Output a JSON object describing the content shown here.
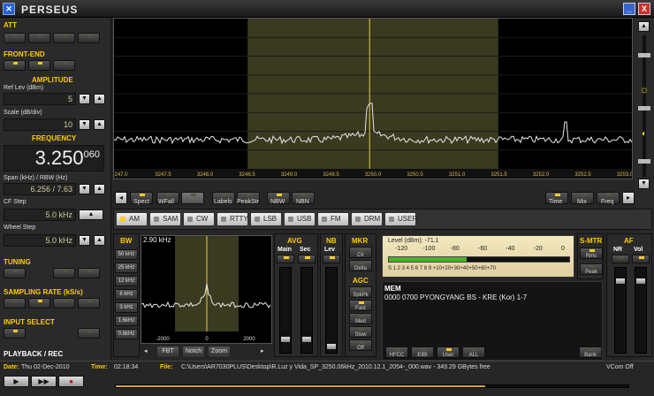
{
  "window": {
    "title": "PERSEUS",
    "minimize_label": "_",
    "close_label": "X"
  },
  "left": {
    "att_title": "ATT",
    "frontend_title": "FRONT-END",
    "amplitude_title": "AMPLITUDE",
    "ref_lev_label": "Ref Lev (dBm)",
    "ref_lev_value": "5",
    "scale_label": "Scale (dB/div)",
    "scale_value": "10",
    "frequency_title": "FREQUENCY",
    "frequency_main": "3.250",
    "frequency_sub": "060",
    "span_label": "Span (kHz) / RBW (Hz)",
    "span_value": "6.256 / 7.63",
    "cf_step_label": "CF Step",
    "cf_step_value": "5.0 kHz",
    "wheel_step_label": "Wheel Step",
    "wheel_step_value": "5.0 kHz",
    "tuning_title": "TUNING",
    "sampling_title": "SAMPLING RATE (kS/s)",
    "input_title": "INPUT SELECT",
    "playback_title": "PLAYBACK / REC",
    "arrow_up": "▲",
    "arrow_down": "▼"
  },
  "spectrum": {
    "x_ticks": [
      "247.0",
      "3247.5",
      "3248.0",
      "3248.5",
      "3249.0",
      "3249.5",
      "3250.0",
      "3250.5",
      "3251.0",
      "3251.5",
      "3252.0",
      "3252.5",
      "3253.0"
    ],
    "passband_from": 3248.6,
    "passband_to": 3251.6,
    "center": 3250.06
  },
  "under_buttons": {
    "spect": "Spect",
    "wfall": "WFall",
    "labels": "Labels",
    "peakstr": "PeakStr",
    "nbw": "NBW",
    "nbn": "NBN",
    "time": "Time",
    "mix": "Mix",
    "freq": "Freq"
  },
  "modes": [
    {
      "label": "AM",
      "active": true
    },
    {
      "label": "SAM",
      "active": false
    },
    {
      "label": "CW",
      "active": false
    },
    {
      "label": "RTTY",
      "active": false
    },
    {
      "label": "LSB",
      "active": false
    },
    {
      "label": "USB",
      "active": false
    },
    {
      "label": "FM",
      "active": false
    },
    {
      "label": "DRM",
      "active": false
    },
    {
      "label": "USER",
      "active": false
    }
  ],
  "bw": {
    "title": "BW",
    "items": [
      "50 kHz",
      "25 kHz",
      "12 kHz",
      "6 kHz",
      "3 kHz",
      "1.6kHz",
      "0.8kHz"
    ],
    "scope_label": "2.90 kHz",
    "scope_ticks": [
      "-2000",
      "0",
      "2000"
    ],
    "fbt": "FBT",
    "notch": "Notch",
    "zoom": "Zoom"
  },
  "avg": {
    "title": "AVG",
    "main": "Main",
    "sec": "Sec"
  },
  "nb": {
    "title": "NB",
    "lev": "Lev"
  },
  "mkr": {
    "title": "MKR",
    "clr": "Clr",
    "delta": "Delta"
  },
  "agc": {
    "title": "AGC",
    "options": [
      "SpkPk",
      "Fast",
      "Med",
      "Slow",
      "Off"
    ]
  },
  "meter": {
    "level_text": "Level (dBm): -71.1",
    "dbm_scale": [
      "-120",
      "-100",
      "-80",
      "-60",
      "-40",
      "-20",
      "0"
    ],
    "s_scale": "S 1 2 3 4 5 6 7 8 9 +10+20+30+40+50+60+70",
    "fill_fraction": 0.43
  },
  "smtr": {
    "title": "S-MTR",
    "rms": "Rms",
    "peak": "Peak"
  },
  "af": {
    "title": "AF",
    "nr": "NR",
    "vol": "Vol"
  },
  "mem": {
    "title": "MEM",
    "entry": "0000 0700 PYONGYANG BS  - KRE (Kor)  1-7",
    "hfcc": "HFCC",
    "eibi": "EIBI",
    "user": "User",
    "all": "ALL",
    "bank": "Bank"
  },
  "status": {
    "date_label": "Date:",
    "date_value": "Thu 02-Dec-2010",
    "time_label": "Time:",
    "time_value": "02:18:34",
    "file_label": "File:",
    "file_value": "C:\\Users\\AR7030PLUS\\Desktop\\R.Luz y Vida_SP_3250.06kHz_2010.12.1_2054-_000.wav - 349.29 GBytes free",
    "vcom": "VCom Off",
    "progress_fraction": 0.72
  },
  "colors": {
    "accent": "#ffcc00",
    "led_on": "#ffcc22",
    "passband": "#4a4a2a",
    "trace": "#e8e8e8"
  }
}
